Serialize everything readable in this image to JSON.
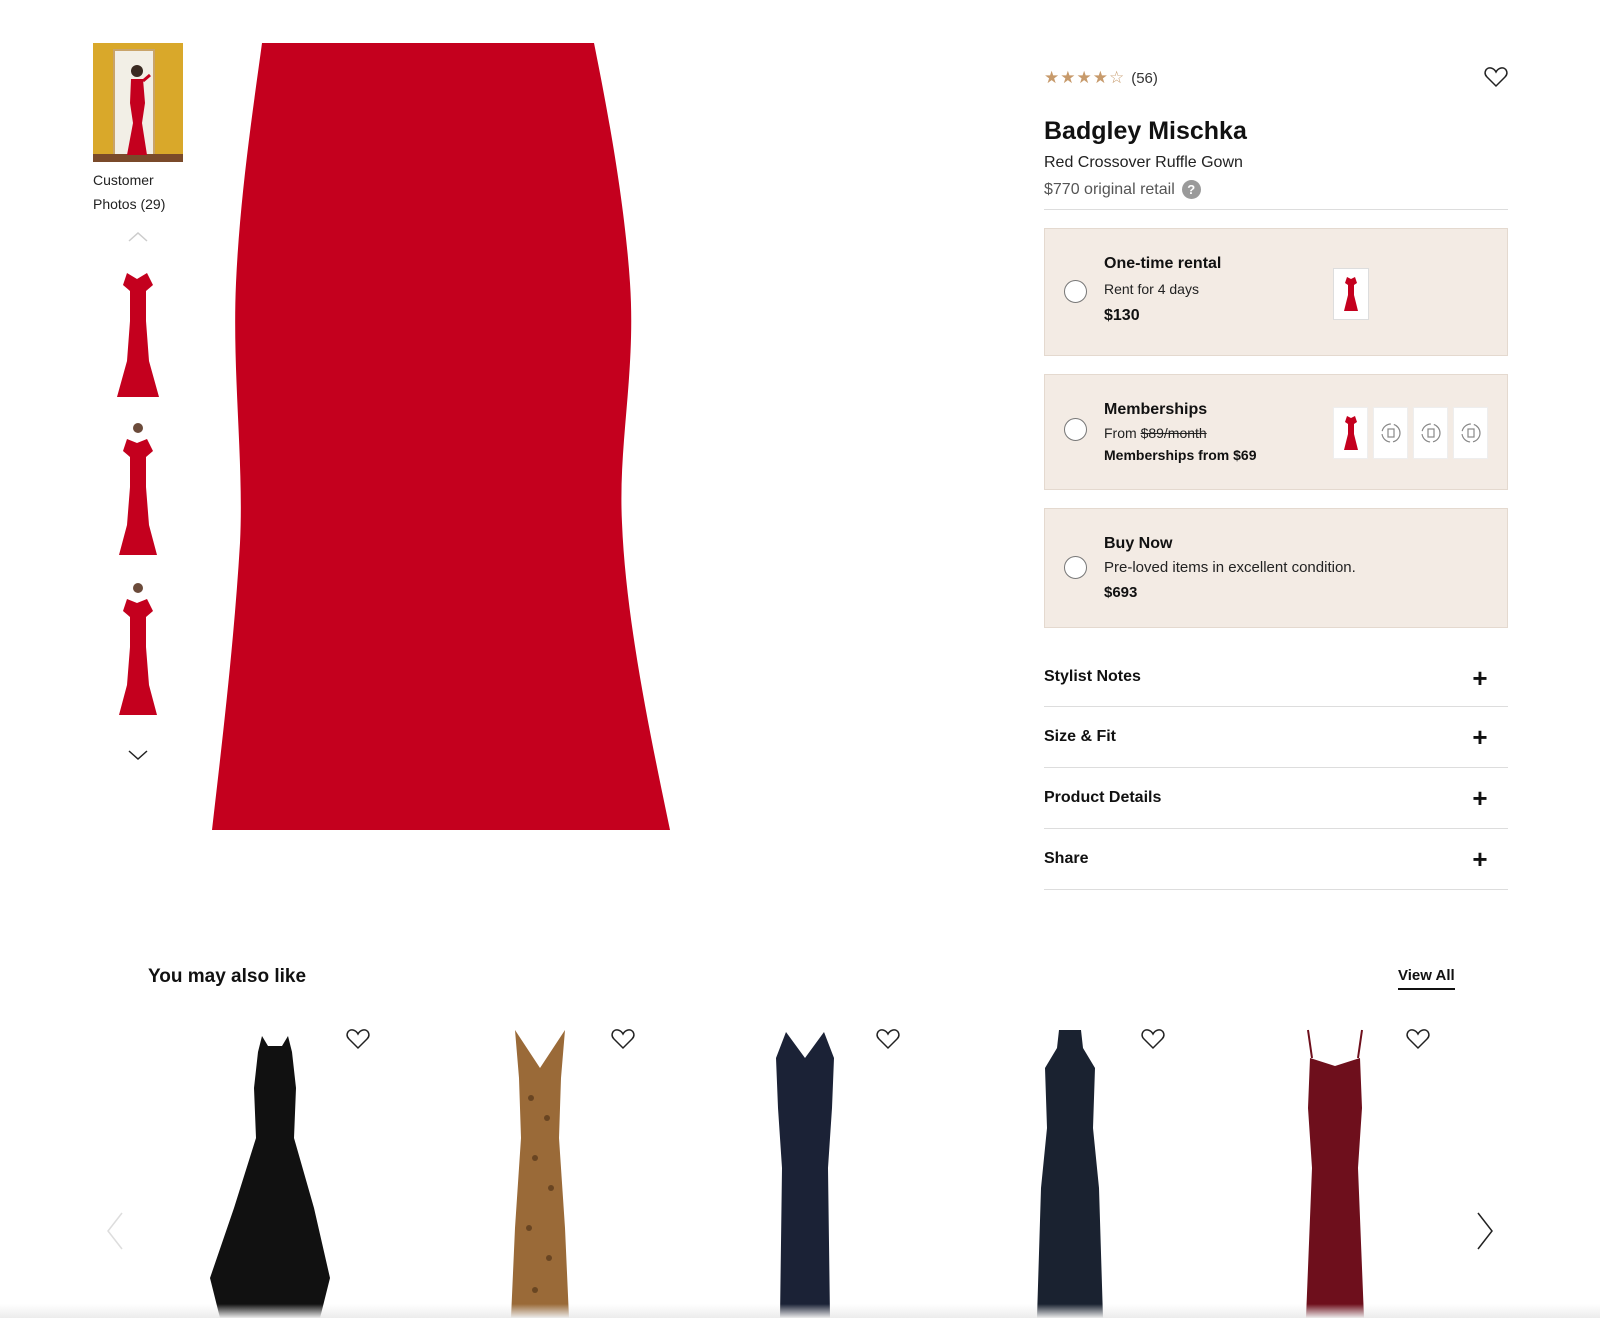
{
  "gallery": {
    "customer_photos_label": "Customer Photos (29)",
    "thumbnail_count": 3
  },
  "product": {
    "rating_stars": 4.5,
    "review_count": "(56)",
    "brand": "Badgley Mischka",
    "name": "Red Crossover Ruffle Gown",
    "retail": "$770 original retail",
    "help_icon": "?",
    "dress_color": "#c4001e"
  },
  "options": {
    "rental": {
      "title": "One-time rental",
      "subtitle": "Rent for 4 days",
      "price": "$130"
    },
    "membership": {
      "title": "Memberships",
      "from_prefix": "From",
      "struck_price": "$89/month",
      "member_price": "Memberships from $69"
    },
    "buy": {
      "title": "Buy Now",
      "subtitle": "Pre-loved items in excellent condition.",
      "price": "$693"
    }
  },
  "accordion": [
    {
      "label": "Stylist Notes",
      "icon": "plus-icon"
    },
    {
      "label": "Size & Fit",
      "icon": "plus-icon"
    },
    {
      "label": "Product Details",
      "icon": "plus-icon"
    },
    {
      "label": "Share",
      "icon": "plus-icon"
    }
  ],
  "recommendations": {
    "title": "You may also like",
    "view_all": "View All",
    "items": [
      {
        "color": "#111111",
        "style": "halter-asymmetric"
      },
      {
        "color": "#9a6a38",
        "style": "leopard-slip"
      },
      {
        "color": "#1b2236",
        "style": "v-neck-slit"
      },
      {
        "color": "#1a2230",
        "style": "halter-column"
      },
      {
        "color": "#6e0f1c",
        "style": "cami-slit"
      }
    ]
  },
  "colors": {
    "option_bg": "#f3ebe4",
    "star": "#c79a6b"
  }
}
